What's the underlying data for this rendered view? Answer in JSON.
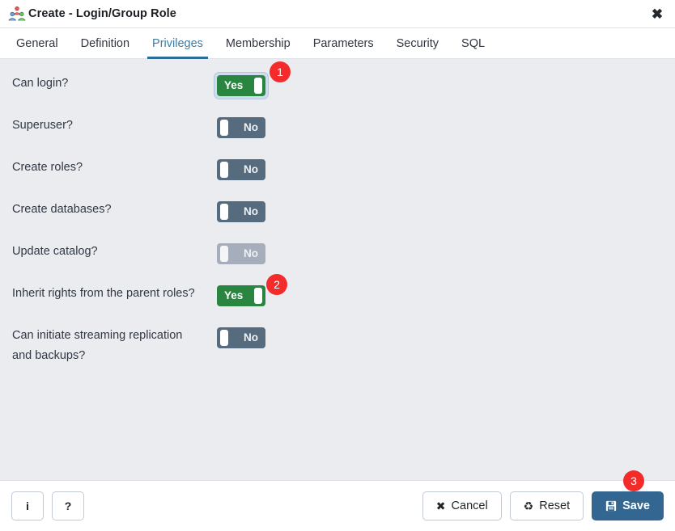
{
  "window": {
    "title": "Create - Login/Group Role",
    "icon": "login-group-role-icon",
    "close_label": "✖"
  },
  "tabs": [
    {
      "label": "General",
      "active": false
    },
    {
      "label": "Definition",
      "active": false
    },
    {
      "label": "Privileges",
      "active": true
    },
    {
      "label": "Membership",
      "active": false
    },
    {
      "label": "Parameters",
      "active": false
    },
    {
      "label": "Security",
      "active": false
    },
    {
      "label": "SQL",
      "active": false
    }
  ],
  "privileges": {
    "rows": [
      {
        "label": "Can login?",
        "value": "Yes",
        "state": "on",
        "focused": true,
        "badge": "1"
      },
      {
        "label": "Superuser?",
        "value": "No",
        "state": "off",
        "focused": false,
        "badge": ""
      },
      {
        "label": "Create roles?",
        "value": "No",
        "state": "off",
        "focused": false,
        "badge": ""
      },
      {
        "label": "Create databases?",
        "value": "No",
        "state": "off",
        "focused": false,
        "badge": ""
      },
      {
        "label": "Update catalog?",
        "value": "No",
        "state": "disabled",
        "focused": false,
        "badge": ""
      },
      {
        "label": "Inherit rights from the parent roles?",
        "value": "Yes",
        "state": "on",
        "focused": false,
        "badge": "2"
      },
      {
        "label": "Can initiate streaming replication and backups?",
        "value": "No",
        "state": "off",
        "focused": false,
        "badge": ""
      }
    ]
  },
  "footer": {
    "info_label": "𝒊",
    "info_glyph": "i",
    "help_glyph": "?",
    "cancel_label": "Cancel",
    "cancel_glyph": "✖",
    "reset_label": "Reset",
    "reset_glyph": "♻",
    "save_label": "Save",
    "save_glyph": "💾",
    "save_badge": "3"
  },
  "colors": {
    "accent": "#336791",
    "tab_active": "#3a7ca8",
    "toggle_on": "#2a8540",
    "toggle_off": "#566b7e",
    "toggle_disabled": "#a5aeba",
    "badge": "#f32b2b",
    "body_bg": "#eaecf0"
  }
}
